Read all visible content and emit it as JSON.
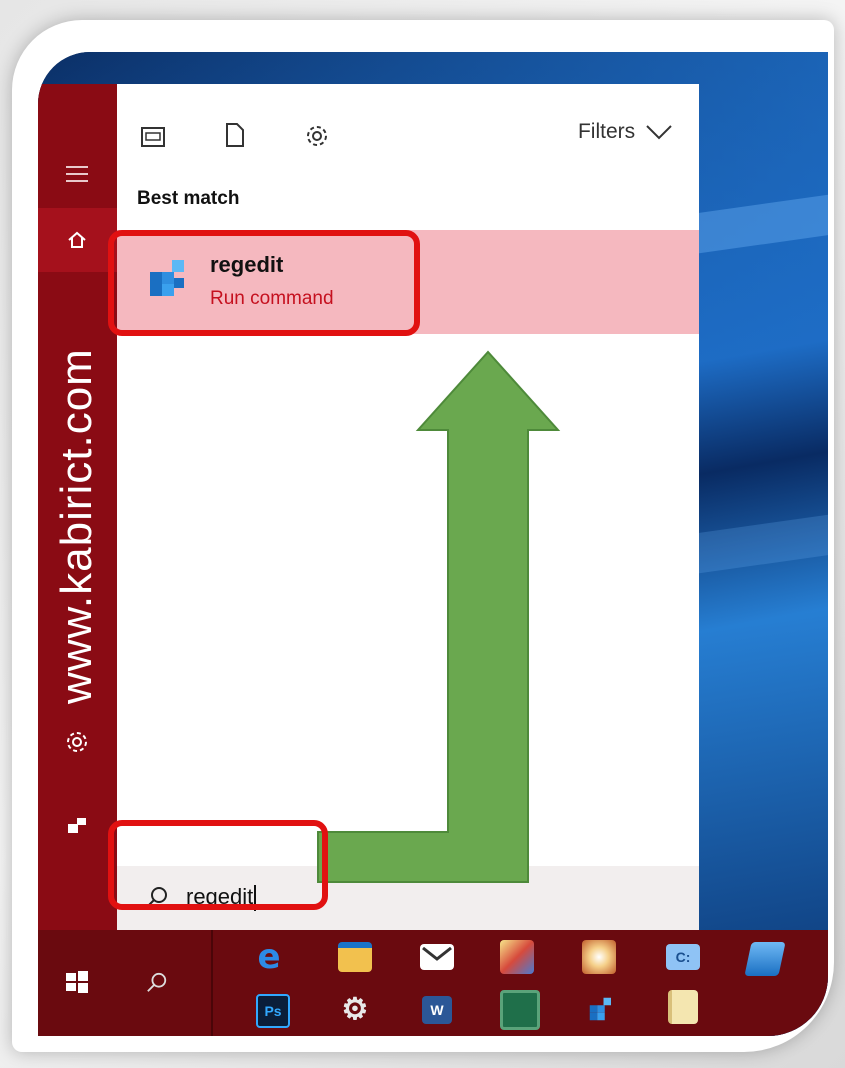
{
  "watermark": "www.kabirict.com",
  "panel": {
    "filters_label": "Filters",
    "best_match_heading": "Best match",
    "result": {
      "name": "regedit",
      "type": "Run command"
    }
  },
  "search": {
    "value": "regedit"
  },
  "colors": {
    "rail": "#8a0b14",
    "result_highlight": "#f5b8bf",
    "annotation_box": "#e11111",
    "annotation_arrow": "#6aa84f",
    "taskbar": "#6a0a0f"
  },
  "taskbar_icons": [
    "edge-icon",
    "file-explorer-icon",
    "mail-icon",
    "paint-icon",
    "paint-brush-icon",
    "control-panel-icon",
    "computer-icon",
    "photoshop-icon",
    "settings-gears-icon",
    "word-icon",
    "network-game-icon",
    "regedit-icon",
    "notes-scroll-icon"
  ],
  "taskbar_labels": {
    "photoshop": "Ps",
    "word": "W"
  }
}
